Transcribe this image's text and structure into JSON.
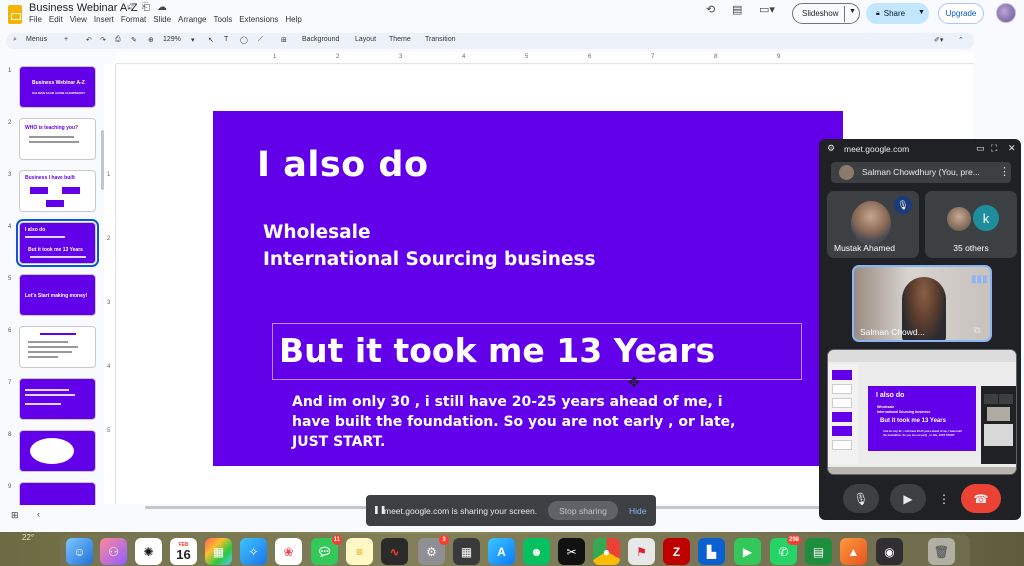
{
  "doc": {
    "title": "Business Webinar A-Z",
    "menus": [
      "File",
      "Edit",
      "View",
      "Insert",
      "Format",
      "Slide",
      "Arrange",
      "Tools",
      "Extensions",
      "Help"
    ]
  },
  "header": {
    "slideshow_label": "Slideshow",
    "share_label": "Share",
    "upgrade_label": "Upgrade"
  },
  "toolbar": {
    "menus_label": "Menus",
    "zoom": "129%",
    "background_label": "Background",
    "layout_label": "Layout",
    "theme_label": "Theme",
    "transition_label": "Transition"
  },
  "ruler": {
    "h_ticks": [
      "1",
      "2",
      "3",
      "4",
      "5",
      "6",
      "7",
      "8",
      "9"
    ],
    "v_ticks": [
      "1",
      "2",
      "3",
      "4",
      "5"
    ]
  },
  "filmstrip": {
    "slides": [
      {
        "num": "1",
        "style": "purple",
        "texts": [
          "Business Webinar A-Z",
          "SALMAN SAAD AUDIB CHOWDHURY"
        ]
      },
      {
        "num": "2",
        "style": "white",
        "texts": [
          "WHO is teaching you?"
        ]
      },
      {
        "num": "3",
        "style": "white",
        "texts": [
          "Business I have built"
        ]
      },
      {
        "num": "4",
        "style": "purple",
        "texts": [
          "I also do",
          "But it took me 13 Years"
        ],
        "selected": true
      },
      {
        "num": "5",
        "style": "purple",
        "texts": [
          "Let's Start making money!"
        ]
      },
      {
        "num": "6",
        "style": "white",
        "texts": []
      },
      {
        "num": "7",
        "style": "purple",
        "texts": []
      },
      {
        "num": "8",
        "style": "purple",
        "texts": []
      },
      {
        "num": "9",
        "style": "purple",
        "texts": []
      }
    ]
  },
  "slide": {
    "title": "I also do",
    "sub_line1": "Wholesale",
    "sub_line2": "International Sourcing business",
    "big": "But it took me 13 Years",
    "body": "And im only 30 , i still have 20-25 years ahead of me, i have built the foundation. So you are not early , or late, JUST START."
  },
  "sharebar": {
    "message": "meet.google.com is sharing your screen.",
    "stop_label": "Stop sharing",
    "hide_label": "Hide"
  },
  "meet": {
    "url": "meet.google.com",
    "presenter_pill": "Salman Chowdhury (You, pre...",
    "tile1_name": "Mustak Ahamed",
    "tile2_initial": "k",
    "tile2_label": "35 others",
    "tile3_name": "Salman Chowd..."
  },
  "mini": {
    "title": "I also do",
    "sub1": "Wholesale",
    "sub2": "International Sourcing business",
    "big": "But it took me 13 Years",
    "body": "And im only 30 , i still have 20-25 years ahead of me, i have built the foundation. So you are not early , or late, JUST START."
  },
  "dock": {
    "weather": "22°",
    "calendar_month": "FEB",
    "calendar_day": "16",
    "messages_badge": "11",
    "settings_badge": "3",
    "whatsapp_badge": "298"
  },
  "colors": {
    "slide_bg": "#6200ea",
    "share_bg": "#c2e7ff",
    "meet_bg": "#202124",
    "end_call": "#ea4335"
  }
}
